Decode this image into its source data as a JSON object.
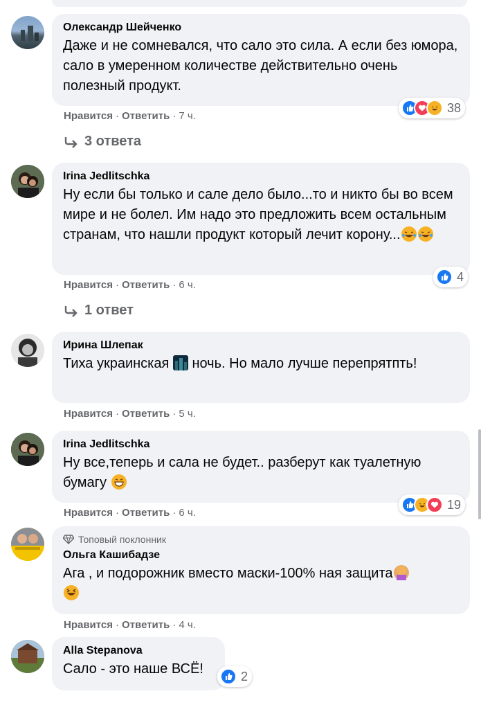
{
  "colors": {
    "bubble": "#f0f2f5",
    "muted": "#65676b",
    "like": "#1877f2",
    "love": "#f33e58",
    "haha": "#f7b125"
  },
  "action_like": "Нравится",
  "action_reply": "Ответить",
  "comments": [
    {
      "author": "Олександр Шейченко",
      "text": "Даже и не сомневался, что сало это сила. А если без юмора, сало в умеренном количестве действительно очень полезный продукт.",
      "time": "7 ч.",
      "reactions": [
        "like-icon",
        "love-icon",
        "haha-icon"
      ],
      "reaction_count": "38",
      "replies_label": "3 ответа"
    },
    {
      "author": "Irina Jedlitschka",
      "text": "Ну если бы только и сале дело было...то и никто бы во всем мире и не болел. Им надо это предложить всем остальным странам, что нашли продукт который лечит корону...",
      "text_emoji": [
        "crying-laughing-emoji",
        "crying-laughing-emoji"
      ],
      "time": "6 ч.",
      "reactions": [
        "like-icon"
      ],
      "reaction_count": "4",
      "replies_label": "1 ответ"
    },
    {
      "author": "Ирина Шлепак",
      "text_before": "Тиха украинская",
      "text_emoji": [
        "night-city-emoji"
      ],
      "text_after": "ночь. Но мало лучше перепрятпть!",
      "time": "5 ч."
    },
    {
      "author": "Irina Jedlitschka",
      "text": "Ну все,теперь и сала не будет.. разберут как туалетную бумагу",
      "text_emoji": [
        "grinning-emoji"
      ],
      "time": "6 ч.",
      "reactions": [
        "like-icon",
        "haha-icon",
        "love-icon"
      ],
      "reaction_count": "19"
    },
    {
      "badge": "Топовый поклонник",
      "author": "Ольга Кашибадзе",
      "text": "Ага , и подорожник вместо маски-100% ная защита",
      "text_emoji": [
        "woman-facepalming-emoji",
        "laughing-emoji"
      ],
      "time": "4 ч."
    },
    {
      "author": "Alla Stepanova",
      "text": "Сало - это наше ВСЁ!",
      "reactions": [
        "like-icon"
      ],
      "reaction_count": "2"
    }
  ]
}
